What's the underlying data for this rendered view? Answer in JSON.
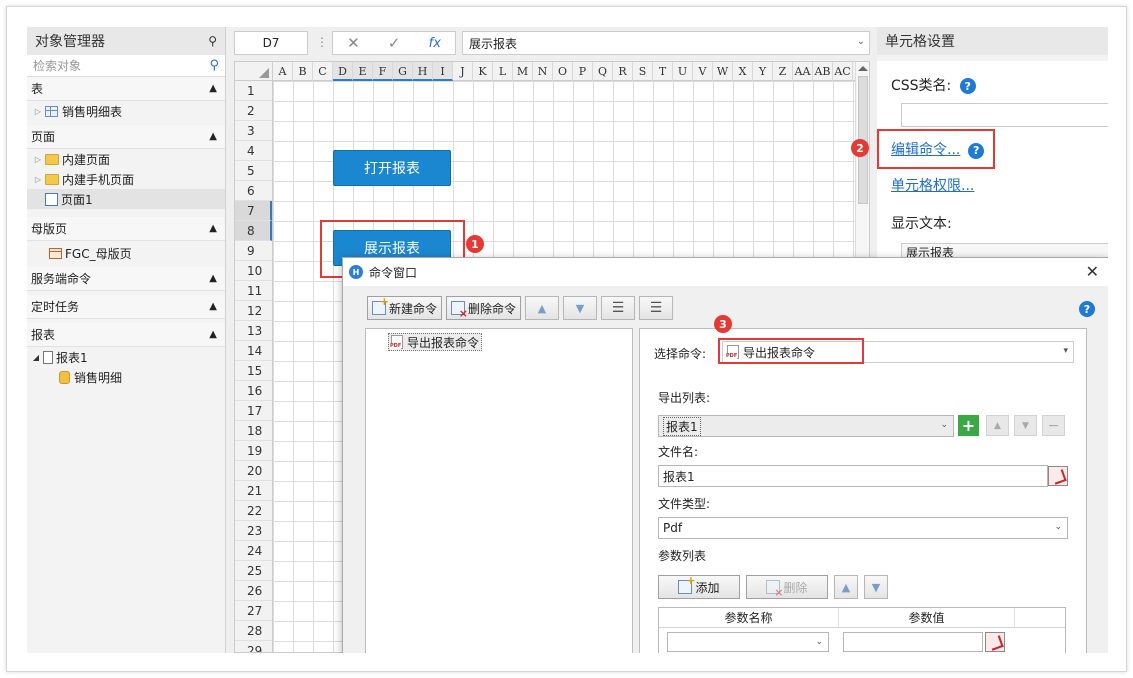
{
  "left_panel": {
    "title": "对象管理器",
    "pin_icon": "pin-icon",
    "search_placeholder": "检索对象",
    "sections": {
      "tables": "表",
      "table_item": "销售明细表",
      "pages": "页面",
      "page_builtin": "内建页面",
      "page_builtin_mobile": "内建手机页面",
      "page1": "页面1",
      "master": "母版页",
      "master_item": "FGC_母版页",
      "server_cmd": "服务端命令",
      "scheduled": "定时任务",
      "reports": "报表",
      "report1": "报表1",
      "report1_data": "销售明细"
    }
  },
  "toolbar": {
    "cell_ref": "D7",
    "cancel_icon": "✕",
    "confirm_icon": "✓",
    "fx_label": "fx",
    "formula_value": "展示报表"
  },
  "grid": {
    "columns": [
      "A",
      "B",
      "C",
      "D",
      "E",
      "F",
      "G",
      "H",
      "I",
      "J",
      "K",
      "L",
      "M",
      "N",
      "O",
      "P",
      "Q",
      "R",
      "S",
      "T",
      "U",
      "V",
      "W",
      "X",
      "Y",
      "Z",
      "AA",
      "AB",
      "AC"
    ],
    "rows": [
      "1",
      "2",
      "3",
      "4",
      "5",
      "6",
      "7",
      "8",
      "9",
      "10",
      "11",
      "12",
      "13",
      "14",
      "15",
      "16",
      "17",
      "18",
      "19",
      "20",
      "21",
      "22",
      "23",
      "24",
      "25",
      "26",
      "27",
      "28",
      "29"
    ],
    "btn_open": "打开报表",
    "btn_show": "展示报表",
    "marker1": "1"
  },
  "right_panel": {
    "title": "单元格设置",
    "css_label": "CSS类名:",
    "edit_cmd": "编辑命令...",
    "cell_perm": "单元格权限...",
    "display_text_label": "显示文本:",
    "display_text_value": "展示报表",
    "marker2": "2"
  },
  "dialog": {
    "title": "命令窗口",
    "logo": "H",
    "new_cmd": "新建命令",
    "del_cmd": "删除命令",
    "cmd_item": "导出报表命令",
    "marker3": "3",
    "select_cmd_label": "选择命令:",
    "select_cmd_value": "导出报表命令",
    "export_list_label": "导出列表:",
    "export_list_value": "报表1",
    "filename_label": "文件名:",
    "filename_value": "报表1",
    "filetype_label": "文件类型:",
    "filetype_value": "Pdf",
    "param_list_label": "参数列表",
    "add_btn": "添加",
    "del_btn": "删除",
    "col_param_name": "参数名称",
    "col_param_value": "参数值"
  },
  "colors": {
    "accent_blue": "#1b87d1",
    "marker_red": "#e53935",
    "add_green": "#3aa845"
  }
}
